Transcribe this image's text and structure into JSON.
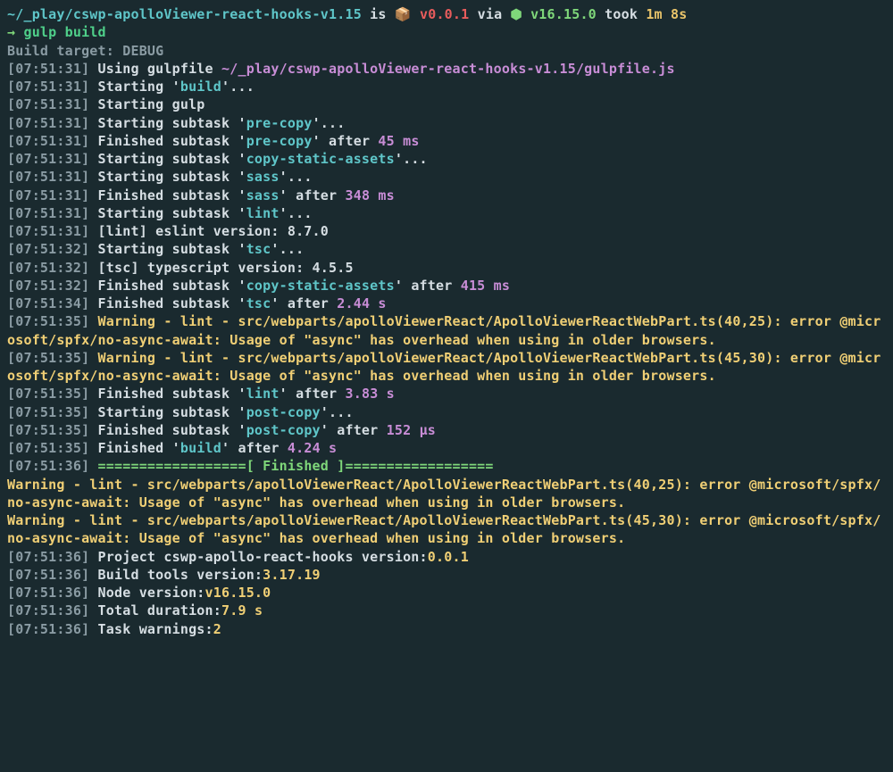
{
  "prompt": {
    "path": "~/_play/cswp-apolloViewer-react-hooks-v1.15",
    "is": " is ",
    "box": "📦 ",
    "version": "v0.0.1",
    "via": " via ",
    "node_icon": "⬢ ",
    "node_version": "v16.15.0",
    "took": " took ",
    "duration": "1m 8s"
  },
  "command": {
    "arrow": "→ ",
    "text": "gulp build"
  },
  "build_target": "Build target: DEBUG",
  "lines": [
    {
      "ts": "[07:51:31]",
      "pre": " Using gulpfile ",
      "path": "~/_play/cswp-apolloViewer-react-hooks-v1.15/gulpfile.js"
    },
    {
      "ts": "[07:51:31]",
      "pre": " Starting '",
      "task": "build",
      "post": "'..."
    },
    {
      "ts": "[07:51:31]",
      "pre": " Starting gulp"
    },
    {
      "ts": "[07:51:31]",
      "pre": " Starting subtask '",
      "task": "pre-copy",
      "post": "'..."
    },
    {
      "ts": "[07:51:31]",
      "pre": " Finished subtask '",
      "task": "pre-copy",
      "post": "' after ",
      "dur": "45 ms"
    },
    {
      "ts": "[07:51:31]",
      "pre": " Starting subtask '",
      "task": "copy-static-assets",
      "post": "'..."
    },
    {
      "ts": "[07:51:31]",
      "pre": " Starting subtask '",
      "task": "sass",
      "post": "'..."
    },
    {
      "ts": "[07:51:31]",
      "pre": " Finished subtask '",
      "task": "sass",
      "post": "' after ",
      "dur": "348 ms"
    },
    {
      "ts": "[07:51:31]",
      "pre": " Starting subtask '",
      "task": "lint",
      "post": "'..."
    },
    {
      "ts": "[07:51:31]",
      "pre": " [lint] eslint version: 8.7.0"
    },
    {
      "ts": "[07:51:32]",
      "pre": " Starting subtask '",
      "task": "tsc",
      "post": "'..."
    },
    {
      "ts": "[07:51:32]",
      "pre": " [tsc] typescript version: 4.5.5"
    },
    {
      "ts": "[07:51:32]",
      "pre": " Finished subtask '",
      "task": "copy-static-assets",
      "post": "' after ",
      "dur": "415 ms"
    },
    {
      "ts": "[07:51:34]",
      "pre": " Finished subtask '",
      "task": "tsc",
      "post": "' after ",
      "dur": "2.44 s"
    }
  ],
  "warn1": {
    "ts": "[07:51:35]",
    "label": " Warning - lint - ",
    "rest": "src/webparts/apolloViewerReact/ApolloViewerReactWebPart.ts(40,25): error @microsoft/spfx/no-async-await: Usage of \"async\" has overhead when using in older browsers."
  },
  "warn2": {
    "ts": "[07:51:35]",
    "label": " Warning - lint - ",
    "rest": "src/webparts/apolloViewerReact/ApolloViewerReactWebPart.ts(45,30): error @microsoft/spfx/no-async-await: Usage of \"async\" has overhead when using in older browsers."
  },
  "lines2": [
    {
      "ts": "[07:51:35]",
      "pre": " Finished subtask '",
      "task": "lint",
      "post": "' after ",
      "dur": "3.83 s"
    },
    {
      "ts": "[07:51:35]",
      "pre": " Starting subtask '",
      "task": "post-copy",
      "post": "'..."
    },
    {
      "ts": "[07:51:35]",
      "pre": " Finished subtask '",
      "task": "post-copy",
      "post": "' after ",
      "dur": "152 μs"
    },
    {
      "ts": "[07:51:35]",
      "pre": " Finished '",
      "task": "build",
      "post": "' after ",
      "dur": "4.24 s"
    }
  ],
  "finished": {
    "ts": "[07:51:36]",
    "left": " ==================[ ",
    "mid": "Finished",
    "right": " ]=================="
  },
  "final_warn1": "Warning - lint - src/webparts/apolloViewerReact/ApolloViewerReactWebPart.ts(40,25): error @microsoft/spfx/no-async-await: Usage of \"async\" has overhead when using in older browsers.",
  "final_warn2": "Warning - lint - src/webparts/apolloViewerReact/ApolloViewerReactWebPart.ts(45,30): error @microsoft/spfx/no-async-await: Usage of \"async\" has overhead when using in older browsers.",
  "summary": [
    {
      "ts": "[07:51:36]",
      "pre": " Project cswp-apollo-react-hooks version:",
      "val": "0.0.1"
    },
    {
      "ts": "[07:51:36]",
      "pre": " Build tools version:",
      "val": "3.17.19"
    },
    {
      "ts": "[07:51:36]",
      "pre": " Node version:",
      "val": "v16.15.0"
    },
    {
      "ts": "[07:51:36]",
      "pre": " Total duration:",
      "val": "7.9 s"
    },
    {
      "ts": "[07:51:36]",
      "pre": " Task warnings:",
      "val": "2"
    }
  ]
}
